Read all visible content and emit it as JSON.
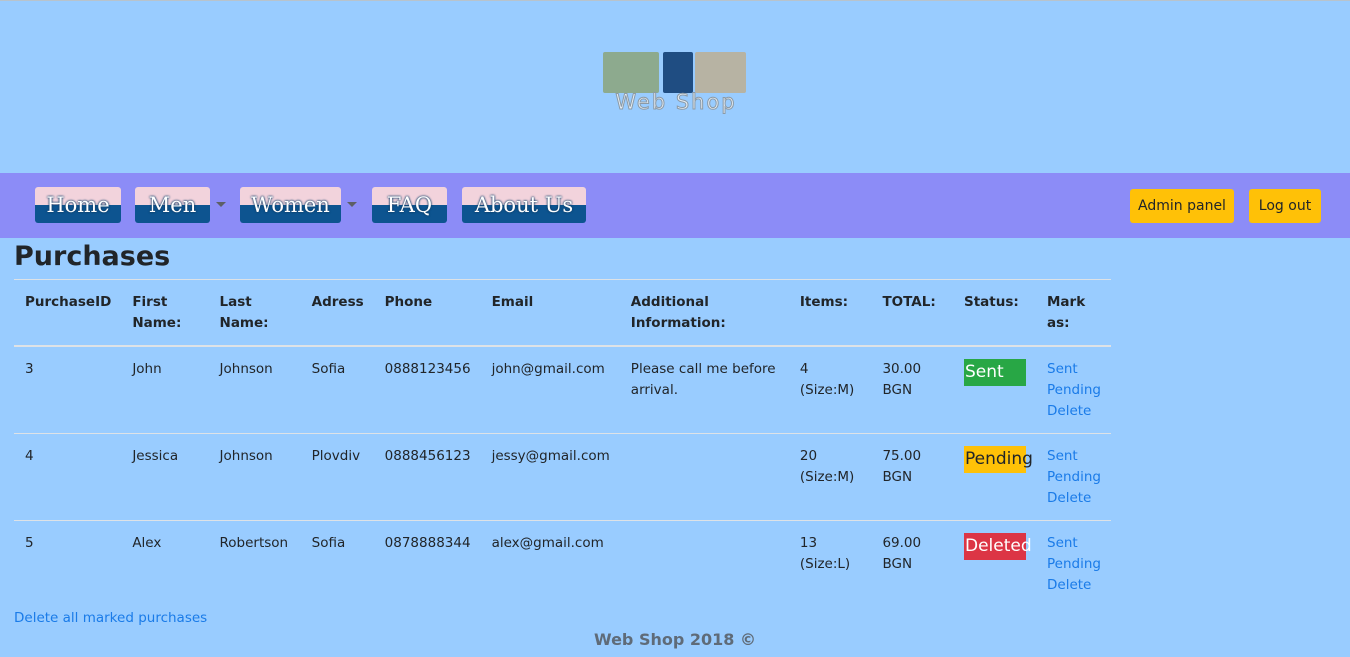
{
  "header": {
    "logo_text": "Web Shop"
  },
  "nav": {
    "items": [
      {
        "label": "Home"
      },
      {
        "label": "Men"
      },
      {
        "label": "Women"
      },
      {
        "label": "FAQ"
      },
      {
        "label": "About Us"
      }
    ],
    "admin_panel_label": "Admin panel",
    "logout_label": "Log out"
  },
  "page": {
    "title": "Purchases"
  },
  "table": {
    "headers": [
      "PurchaseID",
      "First Name:",
      "Last Name:",
      "Adress",
      "Phone",
      "Email",
      "Additional Information:",
      "Items:",
      "TOTAL:",
      "Status:",
      "Mark as:"
    ],
    "rows": [
      {
        "id": "3",
        "first": "John",
        "last": "Johnson",
        "address": "Sofia",
        "phone": "0888123456",
        "email": "john@gmail.com",
        "info": "Please call me before arrival.",
        "items": "4 (Size:M)",
        "total": "30.00 BGN",
        "status": "Sent",
        "status_color": "#28a745"
      },
      {
        "id": "4",
        "first": "Jessica",
        "last": "Johnson",
        "address": "Plovdiv",
        "phone": "0888456123",
        "email": "jessy@gmail.com",
        "info": "",
        "items": "20 (Size:M)",
        "total": "75.00 BGN",
        "status": "Pending",
        "status_color": "#ffc107"
      },
      {
        "id": "5",
        "first": "Alex",
        "last": "Robertson",
        "address": "Sofia",
        "phone": "0878888344",
        "email": "alex@gmail.com",
        "info": "",
        "items": "13 (Size:L)",
        "total": "69.00 BGN",
        "status": "Deleted",
        "status_color": "#dc3545"
      }
    ],
    "actions": {
      "sent": "Sent",
      "pending": "Pending",
      "delete": "Delete"
    }
  },
  "delete_all_label": "Delete all marked purchases",
  "footer": {
    "text": "Web Shop 2018 ©"
  },
  "colors": {
    "page_bg": "#99ccff",
    "navbar_bg": "#8c8cf7",
    "button_yellow": "#ffc107",
    "link_blue": "#1a7be8"
  }
}
